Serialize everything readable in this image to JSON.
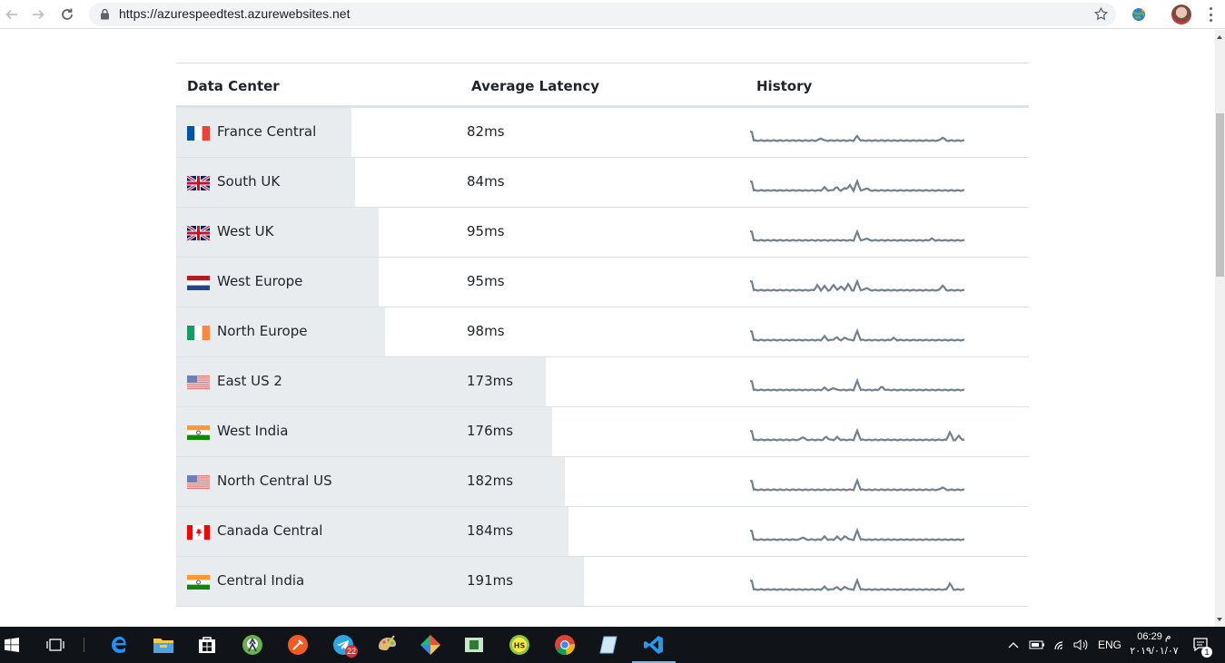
{
  "browser": {
    "url": "https://azurespeedtest.azurewebsites.net"
  },
  "table": {
    "headers": {
      "data_center": "Data Center",
      "average_latency": "Average Latency",
      "history": "History"
    },
    "rows": [
      {
        "name": "France Central",
        "latency": "82ms",
        "latency_ms": 82,
        "flag": "france-flag",
        "spikes": [
          [
            78,
            1.2
          ],
          [
            118,
            2.2
          ],
          [
            212,
            1.6
          ]
        ],
        "start_spike": 1
      },
      {
        "name": "South UK",
        "latency": "84ms",
        "latency_ms": 84,
        "flag": "uk-flag",
        "spikes": [
          [
            82,
            1.5
          ],
          [
            95,
            1.8
          ],
          [
            105,
            1.4
          ],
          [
            110,
            2.5
          ],
          [
            118,
            4.5
          ],
          [
            128,
            1.2
          ]
        ],
        "start_spike": 1
      },
      {
        "name": "West UK",
        "latency": "95ms",
        "latency_ms": 95,
        "flag": "uk-flag",
        "spikes": [
          [
            118,
            4.2
          ],
          [
            128,
            1.0
          ],
          [
            200,
            0.8
          ]
        ],
        "start_spike": 1
      },
      {
        "name": "West Europe",
        "latency": "95ms",
        "latency_ms": 95,
        "flag": "netherlands-flag",
        "spikes": [
          [
            74,
            2.5
          ],
          [
            82,
            2.0
          ],
          [
            92,
            2.8
          ],
          [
            100,
            2.0
          ],
          [
            108,
            3.2
          ],
          [
            118,
            4.3
          ],
          [
            128,
            1.2
          ],
          [
            212,
            2.5
          ]
        ],
        "start_spike": 1
      },
      {
        "name": "North Europe",
        "latency": "98ms",
        "latency_ms": 98,
        "flag": "ireland-flag",
        "spikes": [
          [
            82,
            1.8
          ],
          [
            95,
            1.5
          ],
          [
            105,
            1.4
          ],
          [
            118,
            4.5
          ],
          [
            158,
            1.0
          ]
        ],
        "start_spike": 1
      },
      {
        "name": "East US 2",
        "latency": "173ms",
        "latency_ms": 173,
        "flag": "usa-flag",
        "spikes": [
          [
            82,
            1.0
          ],
          [
            92,
            1.0
          ],
          [
            118,
            4.5
          ],
          [
            145,
            1.8
          ]
        ],
        "start_spike": 1
      },
      {
        "name": "West India",
        "latency": "176ms",
        "latency_ms": 176,
        "flag": "india-flag",
        "spikes": [
          [
            58,
            1.5
          ],
          [
            84,
            1.6
          ],
          [
            96,
            1.3
          ],
          [
            118,
            4.5
          ],
          [
            220,
            3.8
          ],
          [
            230,
            2.0
          ]
        ],
        "start_spike": 1
      },
      {
        "name": "North Central US",
        "latency": "182ms",
        "latency_ms": 182,
        "flag": "usa-flag",
        "spikes": [
          [
            118,
            4.5
          ],
          [
            212,
            1.3
          ]
        ],
        "start_spike": 1
      },
      {
        "name": "Canada Central",
        "latency": "184ms",
        "latency_ms": 184,
        "flag": "canada-flag",
        "spikes": [
          [
            58,
            1.2
          ],
          [
            82,
            1.4
          ],
          [
            96,
            1.4
          ],
          [
            105,
            2.0
          ],
          [
            118,
            4.5
          ]
        ],
        "start_spike": 1
      },
      {
        "name": "Central India",
        "latency": "191ms",
        "latency_ms": 191,
        "flag": "india-flag",
        "spikes": [
          [
            82,
            1.3
          ],
          [
            95,
            1.3
          ],
          [
            105,
            1.5
          ],
          [
            118,
            4.5
          ],
          [
            220,
            3.0
          ]
        ],
        "start_spike": 1
      }
    ]
  },
  "taskbar": {
    "apps": [
      "start-icon",
      "task-view-icon",
      "edge-icon",
      "file-explorer-icon",
      "store-icon",
      "android-studio-icon",
      "postman-icon",
      "telegram-icon",
      "paint-icon",
      "gitkraken-icon",
      "tablet-app-icon",
      "hs-app-icon",
      "chrome-icon",
      "notes-icon",
      "vscode-icon"
    ],
    "telegram_badge": "22",
    "language": "ENG",
    "time": "06:29 م",
    "date": "۲۰۱۹/۰۱/۰۷",
    "notification_count": "1"
  },
  "colors": {
    "latency_bar": "#e9ecef",
    "sparkline": "#708090",
    "taskbar": "#101318"
  }
}
